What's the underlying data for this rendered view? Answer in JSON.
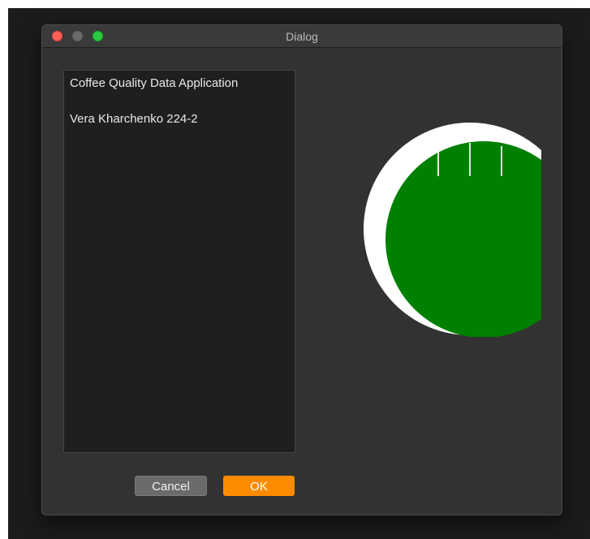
{
  "window": {
    "title": "Dialog"
  },
  "text_panel": {
    "lines": [
      "Coffee Quality Data Application",
      "Vera Kharchenko 224-2"
    ]
  },
  "graphic": {
    "icon": "coffee-cup-top-view-icon",
    "colors": {
      "rim": "#ffffff",
      "liquid": "#008000",
      "steam": "#ffffff"
    }
  },
  "buttons": {
    "cancel_label": "Cancel",
    "ok_label": "OK"
  },
  "colors": {
    "accent": "#ff8c00",
    "window_bg": "#323232",
    "panel_bg": "#1f1f1f"
  }
}
